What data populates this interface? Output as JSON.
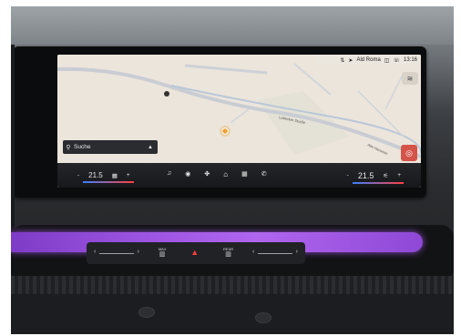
{
  "status_bar": {
    "destination": "Ald Roma",
    "time": "13:16"
  },
  "map": {
    "search_label": "Suche",
    "road_label_1": "Lübecker Straße",
    "road_label_2": "Alte Hansestr"
  },
  "climate": {
    "left_temp": "21.5",
    "right_temp": "21.5",
    "minus": "-",
    "plus": "+"
  },
  "console": {
    "max_label": "MAX",
    "rear_label": "REAR"
  },
  "colors": {
    "ambient": "#9a52e0",
    "destination_button": "#d4544a",
    "hazard": "#ff3b3b"
  }
}
